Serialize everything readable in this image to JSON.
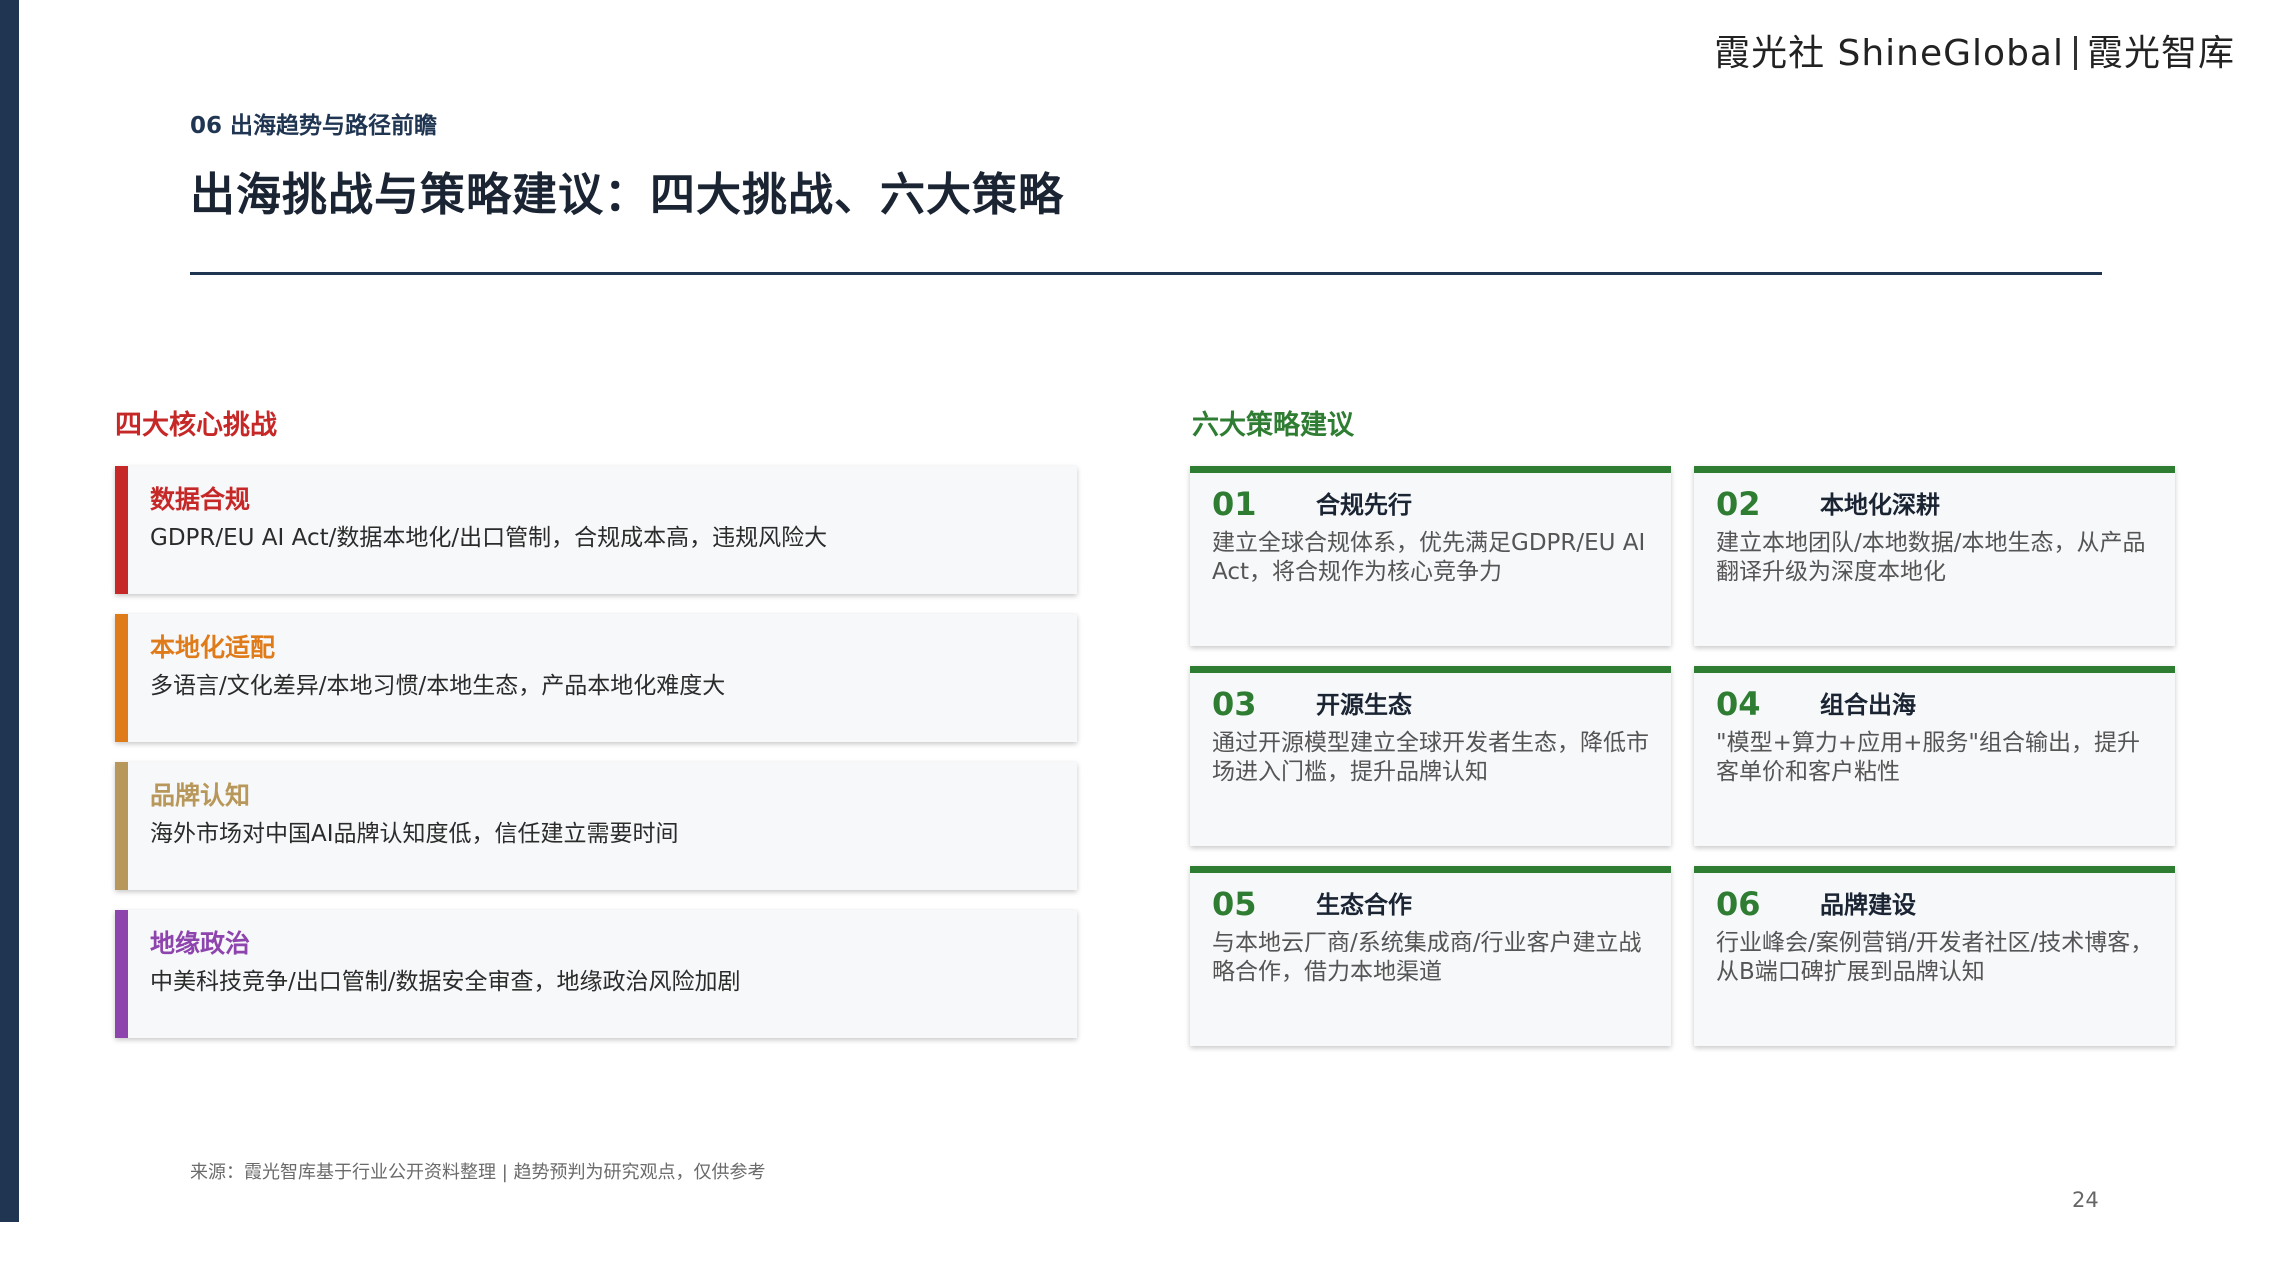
{
  "brand": {
    "left": "霞光社 ShineGlobal",
    "right": "霞光智库"
  },
  "header": {
    "section_label": "06 出海趋势与路径前瞻",
    "title": "出海挑战与策略建议：四大挑战、六大策略"
  },
  "challenges": {
    "heading": "四大核心挑战",
    "items": [
      {
        "title": "数据合规",
        "desc": "GDPR/EU AI Act/数据本地化/出口管制，合规成本高，违规风险大",
        "color": "#c62828"
      },
      {
        "title": "本地化适配",
        "desc": "多语言/文化差异/本地习惯/本地生态，产品本地化难度大",
        "color": "#e07b1a"
      },
      {
        "title": "品牌认知",
        "desc": "海外市场对中国AI品牌认知度低，信任建立需要时间",
        "color": "#b8975a"
      },
      {
        "title": "地缘政治",
        "desc": "中美科技竞争/出口管制/数据安全审查，地缘政治风险加剧",
        "color": "#8e44ad"
      }
    ]
  },
  "strategies": {
    "heading": "六大策略建议",
    "accent": "#2e7d32",
    "items": [
      {
        "num": "01",
        "title": "合规先行",
        "desc": "建立全球合规体系，优先满足GDPR/EU AI Act，将合规作为核心竞争力"
      },
      {
        "num": "02",
        "title": "本地化深耕",
        "desc": "建立本地团队/本地数据/本地生态，从产品翻译升级为深度本地化"
      },
      {
        "num": "03",
        "title": "开源生态",
        "desc": "通过开源模型建立全球开发者生态，降低市场进入门槛，提升品牌认知"
      },
      {
        "num": "04",
        "title": "组合出海",
        "desc": "\"模型+算力+应用+服务\"组合输出，提升客单价和客户粘性"
      },
      {
        "num": "05",
        "title": "生态合作",
        "desc": "与本地云厂商/系统集成商/行业客户建立战略合作，借力本地渠道"
      },
      {
        "num": "06",
        "title": "品牌建设",
        "desc": "行业峰会/案例营销/开发者社区/技术博客，从B端口碑扩展到品牌认知"
      }
    ]
  },
  "footer": {
    "source": "来源：霞光智库基于行业公开资料整理 | 趋势预判为研究观点，仅供参考",
    "page_number": "24"
  }
}
